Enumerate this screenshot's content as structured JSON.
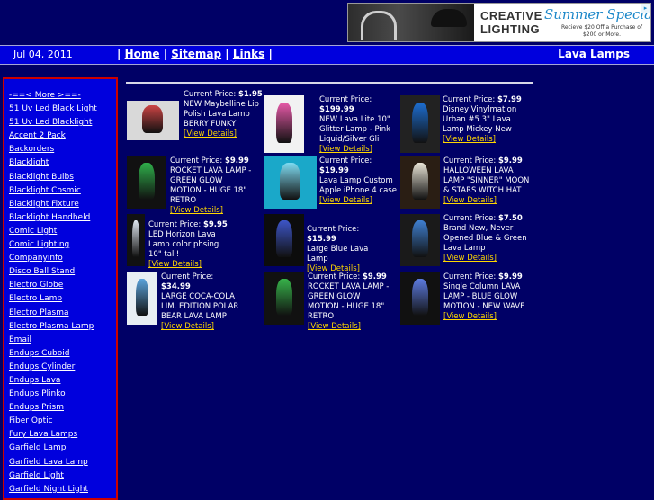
{
  "ad": {
    "brand_line1": "CREATIVE",
    "brand_line2": "LIGHTING",
    "promo_title": "Summer Special",
    "promo_detail": "Recieve $20 Off a Purchase of $200 or More."
  },
  "header": {
    "date": "Jul 04, 2011",
    "nav_sep_left": "|",
    "nav": [
      {
        "label": "Home"
      },
      {
        "label": "Sitemap"
      },
      {
        "label": "Links"
      }
    ],
    "nav_sep": "|",
    "site_title": "Lava Lamps"
  },
  "sidebar": {
    "items": [
      "-==< More >==-",
      "51 Uv Led Black Light",
      "51 Uv Led Blacklight",
      "Accent 2 Pack",
      "Backorders",
      "Blacklight",
      "Blacklight Bulbs",
      "Blacklight Cosmic",
      "Blacklight Fixture",
      "Blacklight Handheld",
      "Comic Light",
      "Comic Lighting",
      "Companyinfo",
      "Disco Ball Stand",
      "Electro Globe",
      "Electro Lamp",
      "Electro Plasma",
      "Electro Plasma Lamp",
      "Email",
      "Endups Cuboid",
      "Endups Cylinder",
      "Endups Lava",
      "Endups Plinko",
      "Endups Prism",
      "Fiber Optic",
      "Fury Lava Lamps",
      "Garfield Lamp",
      "Garfield Lava Lamp",
      "Garfield Light",
      "Garfield Night Light"
    ]
  },
  "products": {
    "price_label": "Current Price:",
    "view_label": "[View Details]",
    "items": [
      {
        "price": "$1.95",
        "title": "NEW Maybelline Lip Polish Lava Lamp BERRY FUNKY"
      },
      {
        "price": "$199.99",
        "title": "NEW Lava Lite 10\" Glitter Lamp - Pink Liquid/Silver Gli"
      },
      {
        "price": "$7.99",
        "title": "Disney Vinylmation Urban #5 3\" Lava Lamp Mickey New"
      },
      {
        "price": "$9.99",
        "title": "ROCKET LAVA LAMP - GREEN GLOW MOTION - HUGE 18\" RETRO"
      },
      {
        "price": "$19.99",
        "title": "Lava Lamp Custom Apple iPhone 4 case"
      },
      {
        "price": "$9.99",
        "title": "HALLOWEEN LAVA LAMP \"SINNER\" MOON & STARS WITCH HAT"
      },
      {
        "price": "$9.95",
        "title": "LED Horizon Lava Lamp color phsing 10\" tall!"
      },
      {
        "price": "$15.99",
        "title": "Large Blue Lava Lamp"
      },
      {
        "price": "$7.50",
        "title": "Brand New, Never Opened Blue & Green Lava Lamp"
      },
      {
        "price": "$34.99",
        "title": "LARGE COCA-COLA LIM. EDITION POLAR BEAR LAVA LAMP"
      },
      {
        "price": "$9.99",
        "title": "ROCKET LAVA LAMP - GREEN GLOW MOTION - HUGE 18\" RETRO"
      },
      {
        "price": "$9.99",
        "title": "Single Column LAVA LAMP - BLUE GLOW MOTION - NEW WAVE"
      }
    ]
  },
  "colors": {
    "background": "#000066",
    "bar": "#0000dd",
    "sidebar_border": "#cc0000",
    "link_highlight": "#ffd700"
  }
}
